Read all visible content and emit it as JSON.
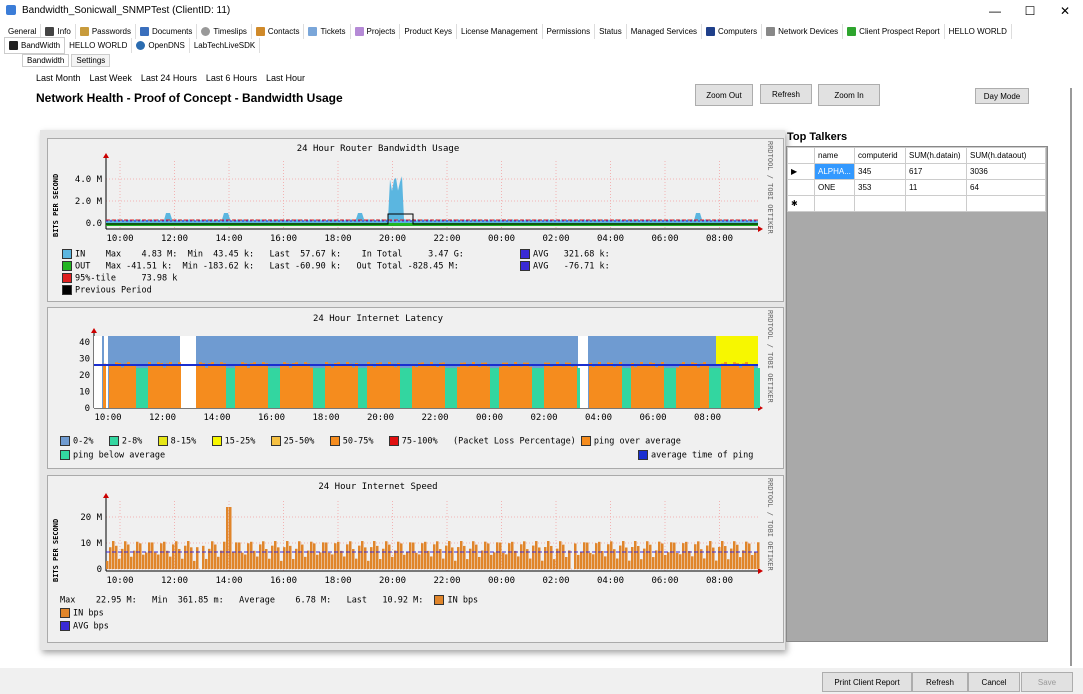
{
  "window": {
    "title": "Bandwidth_Sonicwall_SNMPTest   (ClientID: 11)",
    "min": "—",
    "max": "☐",
    "close": "✕"
  },
  "tabs": [
    "General",
    "Info",
    "Passwords",
    "Documents",
    "Timeslips",
    "Contacts",
    "Tickets",
    "Projects",
    "Product Keys",
    "License Management",
    "Permissions",
    "Status",
    "Managed Services",
    "Computers",
    "Network Devices",
    "Client Prospect Report",
    "HELLO WORLD"
  ],
  "tabs2": [
    "BandWidth",
    "HELLO WORLD",
    "OpenDNS",
    "LabTechLiveSDK"
  ],
  "subtabs": [
    "Bandwidth",
    "Settings"
  ],
  "ranges": [
    "Last Month",
    "Last Week",
    "Last 24 Hours",
    "Last 6 Hours",
    "Last Hour"
  ],
  "heading": "Network Health - Proof of Concept - Bandwidth Usage",
  "buttons": {
    "zoom_out": "Zoom Out",
    "refresh": "Refresh",
    "zoom_in": "Zoom In",
    "day_mode": "Day Mode"
  },
  "xticks": [
    "10:00",
    "12:00",
    "14:00",
    "16:00",
    "18:00",
    "20:00",
    "22:00",
    "00:00",
    "02:00",
    "04:00",
    "06:00",
    "08:00"
  ],
  "rrdtool": "RRDTOOL / TOBI OETIKER",
  "graph1": {
    "title": "24 Hour Router Bandwidth Usage",
    "ylabel": "BITS PER SECOND",
    "yticks": [
      "4.0 M",
      "2.0 M",
      "0.0"
    ],
    "legend": [
      "IN    Max    4.83 M:  Min  43.45 k:   Last  57.67 k:    In Total     3.47 G:",
      "OUT   Max -41.51 k:  Min -183.62 k:   Last -60.90 k:   Out Total -828.45 M:",
      "95%-tile     73.98 k",
      "Previous Period"
    ],
    "avg": [
      "AVG   321.68 k:",
      "AVG   -76.71 k:"
    ]
  },
  "graph2": {
    "title": "24 Hour Internet Latency",
    "yticks": [
      "40",
      "30",
      "20",
      "10",
      "0"
    ],
    "legend1": [
      {
        "label": "0-2%",
        "color": "#6f9bd1"
      },
      {
        "label": "2-8%",
        "color": "#33d6a0"
      },
      {
        "label": "8-15%",
        "color": "#e6e617"
      },
      {
        "label": "15-25%",
        "color": "#f7f700"
      },
      {
        "label": "25-50%",
        "color": "#f5c042"
      },
      {
        "label": "50-75%",
        "color": "#f58c1e"
      },
      {
        "label": "75-100%",
        "color": "#e01010"
      }
    ],
    "loss_label": "(Packet Loss Percentage)",
    "ping_over": "ping over average",
    "ping_below": "ping below average",
    "avg_ping": "average time of ping"
  },
  "graph3": {
    "title": "24 Hour Internet Speed",
    "ylabel": "BITS PER SECOND",
    "yticks": [
      "20 M",
      "10 M",
      "0"
    ],
    "stats": "Max    22.95 M:   Min  361.85 m:   Average    6.78 M:   Last   10.92 M:",
    "in_bps": "IN bps",
    "in_bps2": "IN bps",
    "avg_bps": "AVG bps"
  },
  "top_talkers": {
    "title": "Top Talkers",
    "columns": [
      "name",
      "computerid",
      "SUM(h.datain)",
      "SUM(h.dataout)"
    ],
    "rows": [
      [
        "ALPHA...",
        "345",
        "617",
        "3036"
      ],
      [
        "ONE",
        "353",
        "11",
        "64"
      ]
    ]
  },
  "footer": {
    "print": "Print Client Report",
    "refresh": "Refresh",
    "cancel": "Cancel",
    "save": "Save"
  }
}
